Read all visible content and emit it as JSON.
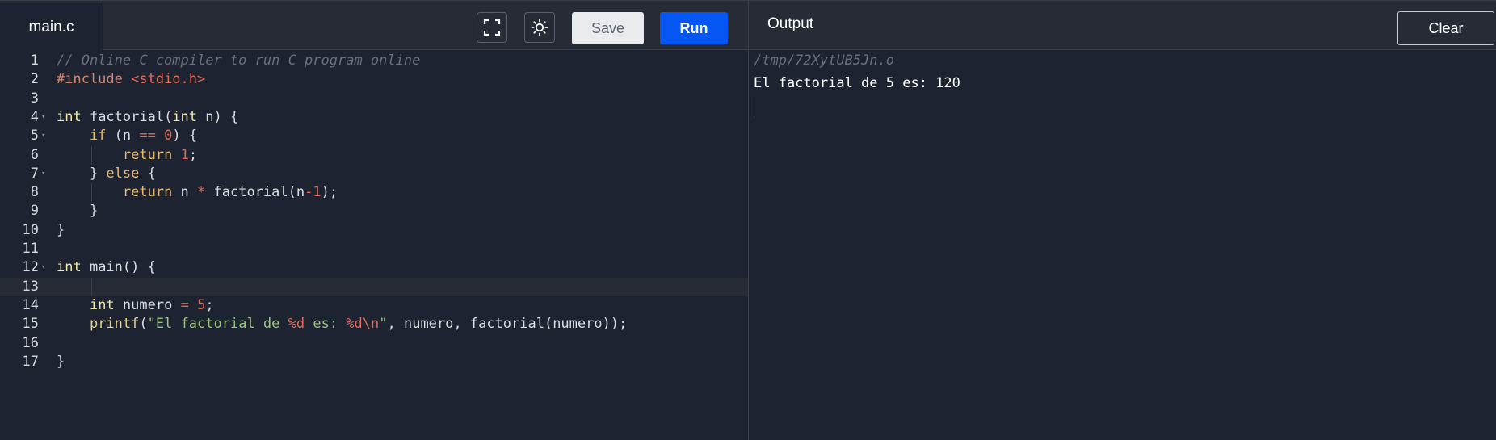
{
  "editor": {
    "file_tab": "main.c",
    "lines": [
      {
        "num": "1",
        "tokens": [
          {
            "t": "// Online C compiler to run C program online",
            "c": "tk-comment"
          }
        ]
      },
      {
        "num": "2",
        "tokens": [
          {
            "t": "#include ",
            "c": "tk-prep"
          },
          {
            "t": "<stdio.h>",
            "c": "tk-prep2"
          }
        ]
      },
      {
        "num": "3",
        "tokens": []
      },
      {
        "num": "4",
        "fold": true,
        "tokens": [
          {
            "t": "int",
            "c": "tk-type"
          },
          {
            "t": " factorial(",
            "c": "tk-plain"
          },
          {
            "t": "int",
            "c": "tk-type"
          },
          {
            "t": " n) {",
            "c": "tk-plain"
          }
        ]
      },
      {
        "num": "5",
        "fold": true,
        "tokens": [
          {
            "t": "    ",
            "c": "tk-plain"
          },
          {
            "t": "if",
            "c": "tk-kw"
          },
          {
            "t": " (n ",
            "c": "tk-plain"
          },
          {
            "t": "==",
            "c": "tk-op"
          },
          {
            "t": " ",
            "c": "tk-plain"
          },
          {
            "t": "0",
            "c": "tk-num"
          },
          {
            "t": ") {",
            "c": "tk-plain"
          }
        ]
      },
      {
        "num": "6",
        "tokens": [
          {
            "t": "        ",
            "c": "tk-plain"
          },
          {
            "t": "return",
            "c": "tk-kw"
          },
          {
            "t": " ",
            "c": "tk-plain"
          },
          {
            "t": "1",
            "c": "tk-num"
          },
          {
            "t": ";",
            "c": "tk-plain"
          }
        ]
      },
      {
        "num": "7",
        "fold": true,
        "tokens": [
          {
            "t": "    } ",
            "c": "tk-plain"
          },
          {
            "t": "else",
            "c": "tk-kw"
          },
          {
            "t": " {",
            "c": "tk-plain"
          }
        ]
      },
      {
        "num": "8",
        "tokens": [
          {
            "t": "        ",
            "c": "tk-plain"
          },
          {
            "t": "return",
            "c": "tk-kw"
          },
          {
            "t": " n ",
            "c": "tk-plain"
          },
          {
            "t": "*",
            "c": "tk-op"
          },
          {
            "t": " factorial(n",
            "c": "tk-plain"
          },
          {
            "t": "-",
            "c": "tk-op"
          },
          {
            "t": "1",
            "c": "tk-num"
          },
          {
            "t": ");",
            "c": "tk-plain"
          }
        ]
      },
      {
        "num": "9",
        "tokens": [
          {
            "t": "    }",
            "c": "tk-plain"
          }
        ]
      },
      {
        "num": "10",
        "tokens": [
          {
            "t": "}",
            "c": "tk-plain"
          }
        ]
      },
      {
        "num": "11",
        "tokens": []
      },
      {
        "num": "12",
        "fold": true,
        "tokens": [
          {
            "t": "int",
            "c": "tk-type"
          },
          {
            "t": " main() {",
            "c": "tk-plain"
          }
        ]
      },
      {
        "num": "13",
        "active": true,
        "tokens": []
      },
      {
        "num": "14",
        "tokens": [
          {
            "t": "    ",
            "c": "tk-plain"
          },
          {
            "t": "int",
            "c": "tk-type"
          },
          {
            "t": " numero ",
            "c": "tk-plain"
          },
          {
            "t": "=",
            "c": "tk-op"
          },
          {
            "t": " ",
            "c": "tk-plain"
          },
          {
            "t": "5",
            "c": "tk-num"
          },
          {
            "t": ";",
            "c": "tk-plain"
          }
        ]
      },
      {
        "num": "15",
        "tokens": [
          {
            "t": "    ",
            "c": "tk-plain"
          },
          {
            "t": "printf",
            "c": "tk-fn"
          },
          {
            "t": "(",
            "c": "tk-plain"
          },
          {
            "t": "\"El factorial de ",
            "c": "tk-str"
          },
          {
            "t": "%d",
            "c": "tk-fmt"
          },
          {
            "t": " es: ",
            "c": "tk-str"
          },
          {
            "t": "%d\\n",
            "c": "tk-fmt"
          },
          {
            "t": "\"",
            "c": "tk-str"
          },
          {
            "t": ", numero, factorial(numero));",
            "c": "tk-plain"
          }
        ]
      },
      {
        "num": "16",
        "tokens": []
      },
      {
        "num": "17",
        "tokens": [
          {
            "t": "}",
            "c": "tk-plain"
          }
        ]
      }
    ]
  },
  "toolbar": {
    "fullscreen_icon": "expand-icon",
    "theme_icon": "sun-icon",
    "save_label": "Save",
    "run_label": "Run"
  },
  "output": {
    "title": "Output",
    "clear_label": "Clear",
    "path_line": "/tmp/72XytUB5Jn.o",
    "result_line": "El factorial de 5 es: 120"
  }
}
